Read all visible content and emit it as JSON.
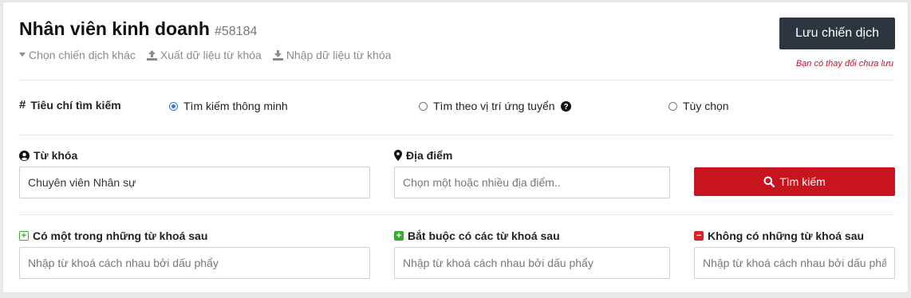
{
  "header": {
    "title": "Nhân viên kinh doanh",
    "campaign_id": "#58184",
    "links": [
      {
        "label": "Chọn chiến dịch khác",
        "icon": "caret-down-icon"
      },
      {
        "label": "Xuất dữ liệu từ khóa",
        "icon": "upload-icon"
      },
      {
        "label": "Nhập dữ liệu từ khóa",
        "icon": "download-icon"
      }
    ],
    "save_label": "Lưu chiến dịch",
    "unsaved_note": "Bạn có thay đổi chưa lưu"
  },
  "criteria": {
    "label": "Tiêu chí tìm kiếm",
    "options": [
      {
        "label": "Tìm kiếm thông minh",
        "selected": true
      },
      {
        "label": "Tìm theo vị trí ứng tuyển",
        "selected": false
      },
      {
        "label": "Tùy chọn",
        "selected": false
      }
    ]
  },
  "search": {
    "keyword_label": "Từ khóa",
    "keyword_value": "Chuyên viên Nhân sự",
    "location_label": "Địa điểm",
    "location_placeholder": "Chọn một hoặc nhiều địa điểm..",
    "button_label": "Tìm kiếm"
  },
  "keywords": {
    "any_label": "Có một trong những từ khoá sau",
    "required_label": "Bắt buộc có các từ khoá sau",
    "excluded_label": "Không có những từ khoá sau",
    "placeholder": "Nhập từ khoá cách nhau bởi dấu phẩy"
  },
  "colors": {
    "primary_dark": "#2d3540",
    "danger": "#c8141e",
    "radio_accent": "#2a7ae2",
    "plus_green": "#3aa935",
    "minus_red": "#d8232a"
  }
}
